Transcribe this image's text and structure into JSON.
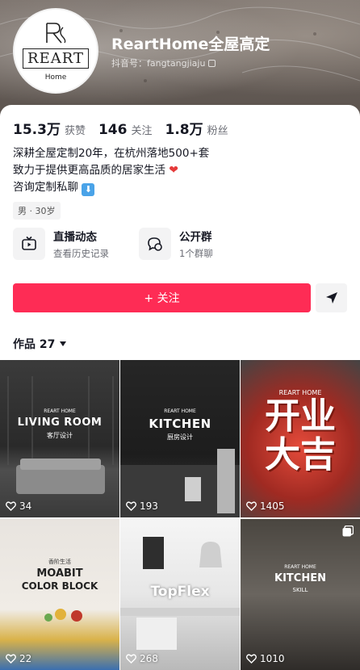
{
  "profile": {
    "avatar_brand": "REART",
    "avatar_sub": "Home",
    "nickname": "ReartHome全屋高定",
    "douyin_id": "抖音号：fangtangjiaju"
  },
  "stats": {
    "likes_num": "15.3万",
    "likes_label": "获赞",
    "following_num": "146",
    "following_label": "关注",
    "fans_num": "1.8万",
    "fans_label": "粉丝"
  },
  "bio": {
    "line1": "深耕全屋定制20年，在杭州落地500+套",
    "line2": "致力于提供更高品质的居家生活",
    "line3": "咨询定制私聊",
    "tag": "男 · 30岁"
  },
  "entries": {
    "live_title": "直播动态",
    "live_sub": "查看历史记录",
    "group_title": "公开群",
    "group_sub": "1个群聊"
  },
  "actions": {
    "follow_label": "+ 关注"
  },
  "works": {
    "tab_label": "作品 27"
  },
  "videos": [
    {
      "brand": "REART HOME",
      "title": "LIVING ROOM",
      "subtitle": "客厅设计",
      "likes": "34"
    },
    {
      "brand": "REART HOME",
      "title": "KITCHEN",
      "subtitle": "厨房设计",
      "likes": "193"
    },
    {
      "brand": "REART HOME",
      "title": "开业",
      "subtitle": "大吉",
      "likes": "1405"
    },
    {
      "brand": "香阶生活",
      "title": "MOABIT",
      "subtitle": "COLOR BLOCK",
      "likes": "22"
    },
    {
      "brand": "",
      "title": "TopFlex",
      "subtitle": "",
      "likes": "268"
    },
    {
      "brand": "REART HOME",
      "title": "KITCHEN",
      "subtitle": "SKILL",
      "likes": "1010"
    }
  ],
  "colors": {
    "accent": "#fe2c55",
    "text_primary": "#161823",
    "text_secondary": "#6b6d75"
  }
}
